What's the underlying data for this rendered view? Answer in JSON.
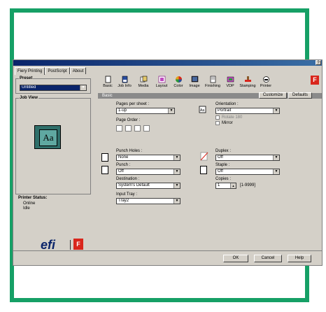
{
  "colors": {
    "frame": "#16a066",
    "accent": "#0a246a",
    "fiery_red": "#d9261c"
  },
  "tabs": [
    "Fiery Printing",
    "PostScript",
    "About"
  ],
  "titlebar": {
    "help": "?"
  },
  "left": {
    "preset_label": "Preset",
    "preset_value": "Untitled",
    "jobview_label": "Job View",
    "jobview_preview": "Aa",
    "printer_status_label": "Printer Status:",
    "status_lines": [
      "Online",
      "Idle"
    ],
    "logo_text": "efi"
  },
  "toolbar": [
    "Basic",
    "Job Info",
    "Media",
    "Layout",
    "Color",
    "Image",
    "Finishing",
    "VDP",
    "Stamping",
    "Printer"
  ],
  "section": {
    "label": "Basic",
    "customize": "Customize",
    "defaults": "Defaults"
  },
  "basic": {
    "pages_per_sheet_label": "Pages per sheet :",
    "pages_per_sheet_value": "1-up",
    "page_order_label": "Page Order :",
    "orientation_label": "Orientation :",
    "orientation_value": "Portrait",
    "rotate_label": "Rotate 180",
    "mirror_label": "Mirror",
    "punch_holes_label": "Punch Holes :",
    "punch_holes_value": "None",
    "punch_label": "Punch :",
    "punch_value": "Off",
    "destination_label": "Destination :",
    "destination_value": "System's Default",
    "input_tray_label": "Input Tray :",
    "input_tray_value": "Tray2",
    "duplex_label": "Duplex :",
    "duplex_value": "Off",
    "staple_label": "Staple :",
    "staple_value": "Off",
    "copies_label": "Copies :",
    "copies_value": "1",
    "copies_range": "[1-9999]"
  },
  "buttons": {
    "ok": "OK",
    "cancel": "Cancel",
    "help": "Help"
  }
}
